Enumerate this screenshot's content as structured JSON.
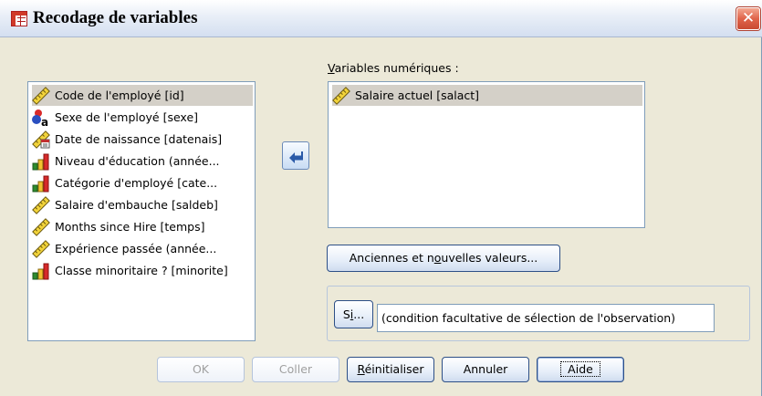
{
  "window": {
    "title": "Recodage de variables",
    "close_label": "✕"
  },
  "source_list": {
    "items": [
      {
        "label": "Code de l'employé [id]",
        "icon": "ruler-icon",
        "selected": true
      },
      {
        "label": "Sexe de l'employé [sexe]",
        "icon": "nominal-string-icon",
        "selected": false
      },
      {
        "label": "Date de naissance [datenais]",
        "icon": "date-ruler-icon",
        "selected": false
      },
      {
        "label": "Niveau d'éducation (année...",
        "icon": "ordinal-bars-icon",
        "selected": false
      },
      {
        "label": "Catégorie d'employé [cate...",
        "icon": "ordinal-bars-icon",
        "selected": false
      },
      {
        "label": "Salaire d'embauche [saldeb]",
        "icon": "ruler-icon",
        "selected": false
      },
      {
        "label": "Months since Hire [temps]",
        "icon": "ruler-icon",
        "selected": false
      },
      {
        "label": "Expérience passée (année...",
        "icon": "ruler-icon",
        "selected": false
      },
      {
        "label": "Classe minoritaire ? [minorite]",
        "icon": "ordinal-bars-icon",
        "selected": false
      }
    ]
  },
  "move_button": {
    "icon": "arrow-left-icon"
  },
  "target": {
    "label_prefix": "",
    "label_underlined": "V",
    "label_rest": "ariables numériques :",
    "items": [
      {
        "label": "Salaire actuel [salact]",
        "icon": "ruler-icon",
        "selected": true
      }
    ]
  },
  "old_new_button": {
    "before": "Anciennes et n",
    "underlined": "o",
    "after": "uvelles valeurs..."
  },
  "condition": {
    "si_before": "S",
    "si_underlined": "i",
    "si_after": "...",
    "text": "(condition facultative de sélection de l'observation)"
  },
  "buttons": {
    "ok": "OK",
    "paste": "Coller",
    "reset_underlined": "R",
    "reset_rest": "éinitialiser",
    "cancel": "Annuler",
    "help": "Aide"
  },
  "colors": {
    "background": "#ece9d8",
    "border_blue": "#7f9db9",
    "button_border": "#2d4f86",
    "selection": "#d4d0c8"
  }
}
